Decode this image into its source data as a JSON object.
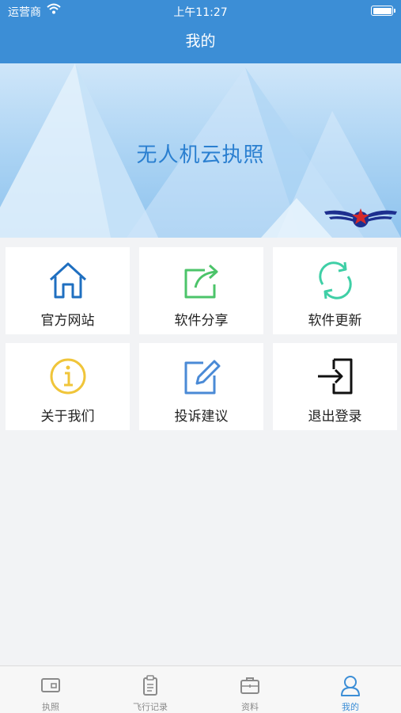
{
  "status_bar": {
    "carrier": "运营商",
    "time": "上午11:27"
  },
  "nav": {
    "title": "我的"
  },
  "banner": {
    "title": "无人机云执照"
  },
  "menu": [
    {
      "label": "官方网站",
      "icon": "house-icon",
      "color": "#1f6fc0"
    },
    {
      "label": "软件分享",
      "icon": "share-icon",
      "color": "#4cc46a"
    },
    {
      "label": "软件更新",
      "icon": "refresh-icon",
      "color": "#3fcfa6"
    },
    {
      "label": "关于我们",
      "icon": "info-icon",
      "color": "#f0c53a"
    },
    {
      "label": "投诉建议",
      "icon": "edit-icon",
      "color": "#4a8ad6"
    },
    {
      "label": "退出登录",
      "icon": "logout-icon",
      "color": "#111111"
    }
  ],
  "tabs": [
    {
      "label": "执照",
      "icon": "license-icon",
      "active": false
    },
    {
      "label": "飞行记录",
      "icon": "clipboard-icon",
      "active": false
    },
    {
      "label": "资料",
      "icon": "briefcase-icon",
      "active": false
    },
    {
      "label": "我的",
      "icon": "user-icon",
      "active": true
    }
  ],
  "colors": {
    "primary": "#3c8ed6",
    "background": "#f2f3f5"
  }
}
